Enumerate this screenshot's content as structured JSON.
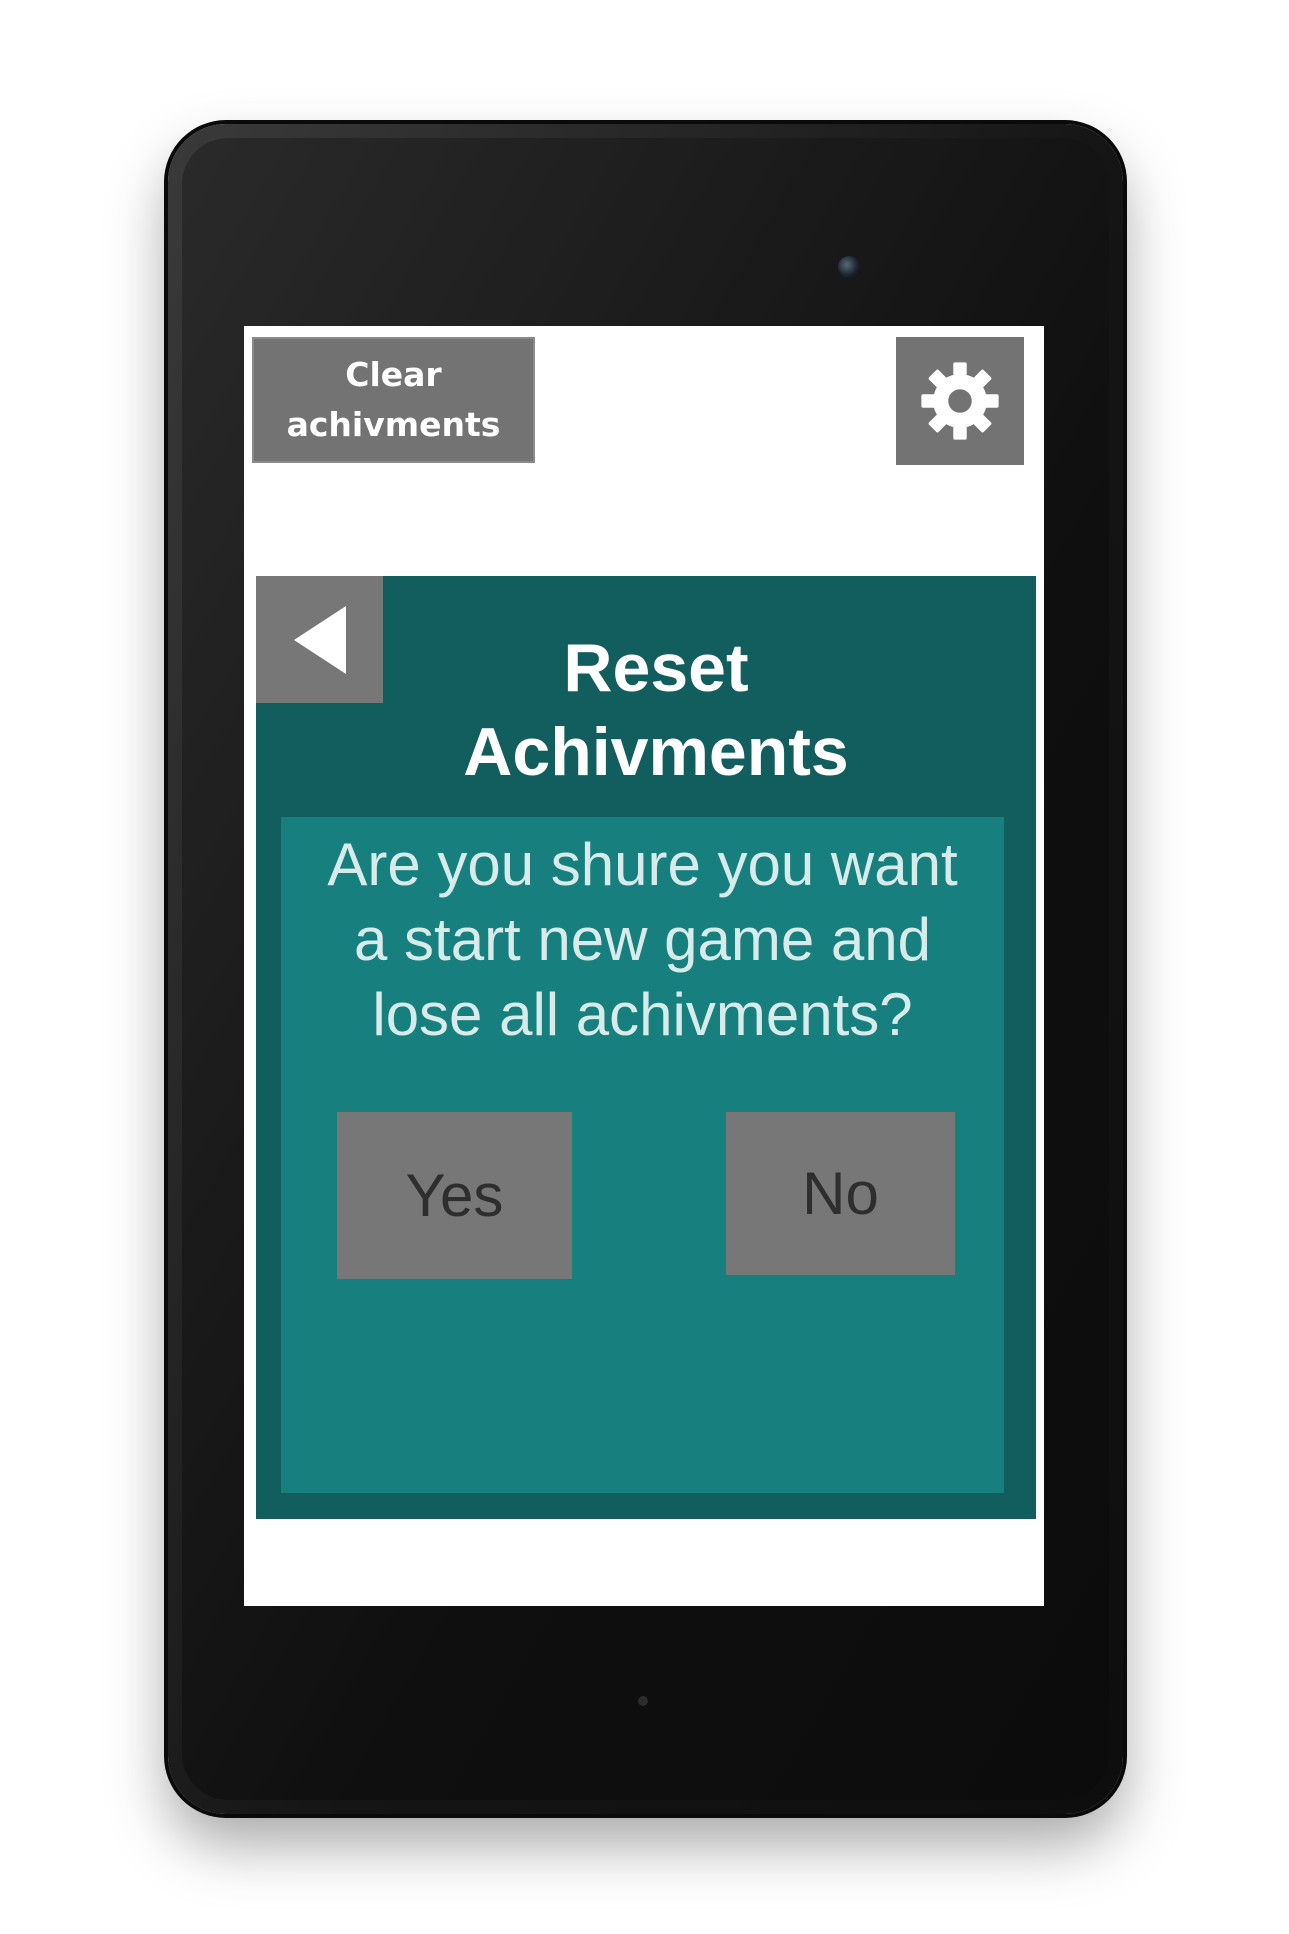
{
  "toolbar": {
    "clear_label_line1": "Clear",
    "clear_label_line2": "achivments",
    "settings_icon": "gear-icon"
  },
  "panel": {
    "back_icon": "back-arrow-icon",
    "title_line1": "Reset",
    "title_line2": "Achivments"
  },
  "dialog": {
    "question_line1": "Are you shure you want",
    "question_line2": "a start new game and",
    "question_line3": "lose all achivments?",
    "yes_label": "Yes",
    "no_label": "No"
  },
  "colors": {
    "panel": "#125e5e",
    "dialog": "#17807f",
    "button": "#737373",
    "text_light": "#ffffff"
  }
}
